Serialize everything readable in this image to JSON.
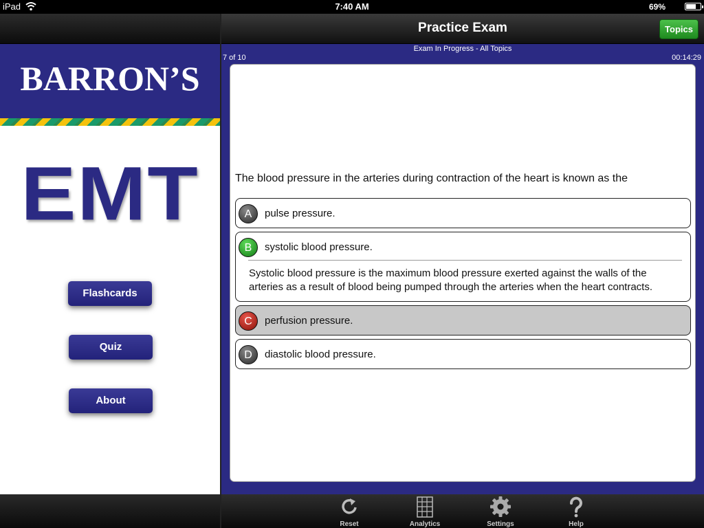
{
  "status_bar": {
    "carrier": "iPad",
    "time": "7:40 AM",
    "battery_percent_text": "69%",
    "battery_level": 0.69
  },
  "sidebar": {
    "brand": "BARRON’S",
    "product": "EMT",
    "menu": [
      {
        "label": "Flashcards"
      },
      {
        "label": "Quiz"
      },
      {
        "label": "About"
      }
    ]
  },
  "header": {
    "title": "Practice Exam",
    "topics_label": "Topics"
  },
  "exam": {
    "status": "Exam In Progress - All Topics",
    "progress": "7 of 10",
    "timer": "00:14:29",
    "question": "The blood pressure in the arteries during contraction of the heart is known as the",
    "options": [
      {
        "letter": "A",
        "text": "pulse pressure.",
        "state": "neutral"
      },
      {
        "letter": "B",
        "text": "systolic blood pressure.",
        "state": "correct",
        "explanation": "Systolic blood pressure is the maximum blood pressure exerted against the walls of the arteries as a result of blood being pumped through the arteries when the heart contracts."
      },
      {
        "letter": "C",
        "text": "perfusion pressure.",
        "state": "wrong-selected"
      },
      {
        "letter": "D",
        "text": "diastolic blood pressure.",
        "state": "neutral"
      }
    ]
  },
  "toolbar": {
    "items": [
      {
        "label": "Reset",
        "icon": "reset-icon"
      },
      {
        "label": "Analytics",
        "icon": "analytics-icon"
      },
      {
        "label": "Settings",
        "icon": "gear-icon"
      },
      {
        "label": "Help",
        "icon": "help-icon"
      }
    ]
  },
  "colors": {
    "brand_navy": "#2b2a83",
    "correct_green": "#1e8a1f",
    "wrong_red": "#8a1209"
  }
}
